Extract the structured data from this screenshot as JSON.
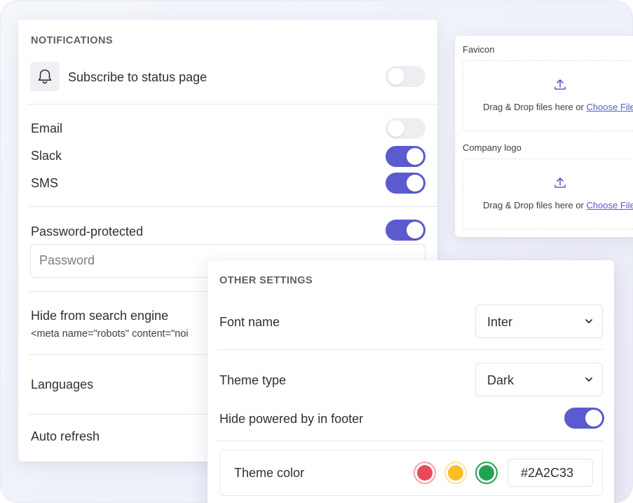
{
  "notifications": {
    "title": "NOTIFICATIONS",
    "subscribe_label": "Subscribe to status page",
    "subscribe_on": false,
    "channels": [
      {
        "label": "Email",
        "on": false
      },
      {
        "label": "Slack",
        "on": true
      },
      {
        "label": "SMS",
        "on": true
      }
    ],
    "password_protected_label": "Password-protected",
    "password_protected_on": true,
    "password_placeholder": "Password",
    "hide_search_label": "Hide from search engine",
    "hide_search_meta": "<meta name=\"robots\" content=\"noi",
    "languages_label": "Languages",
    "auto_refresh_label": "Auto refresh"
  },
  "uploads": {
    "favicon_label": "Favicon",
    "logo_label": "Company logo",
    "drag_text": "Drag & Drop files here or ",
    "choose_link": "Choose File"
  },
  "other_settings": {
    "title": "OTHER SETTINGS",
    "font_name_label": "Font name",
    "font_name_value": "Inter",
    "theme_type_label": "Theme type",
    "theme_type_value": "Dark",
    "hide_powered_label": "Hide powered by in footer",
    "hide_powered_on": true,
    "theme_color_label": "Theme color",
    "theme_color_value": "#2A2C33",
    "swatches": [
      "#e84a5b",
      "#fbbf24",
      "#22a352"
    ]
  },
  "colors": {
    "accent": "#5b5bcf"
  }
}
